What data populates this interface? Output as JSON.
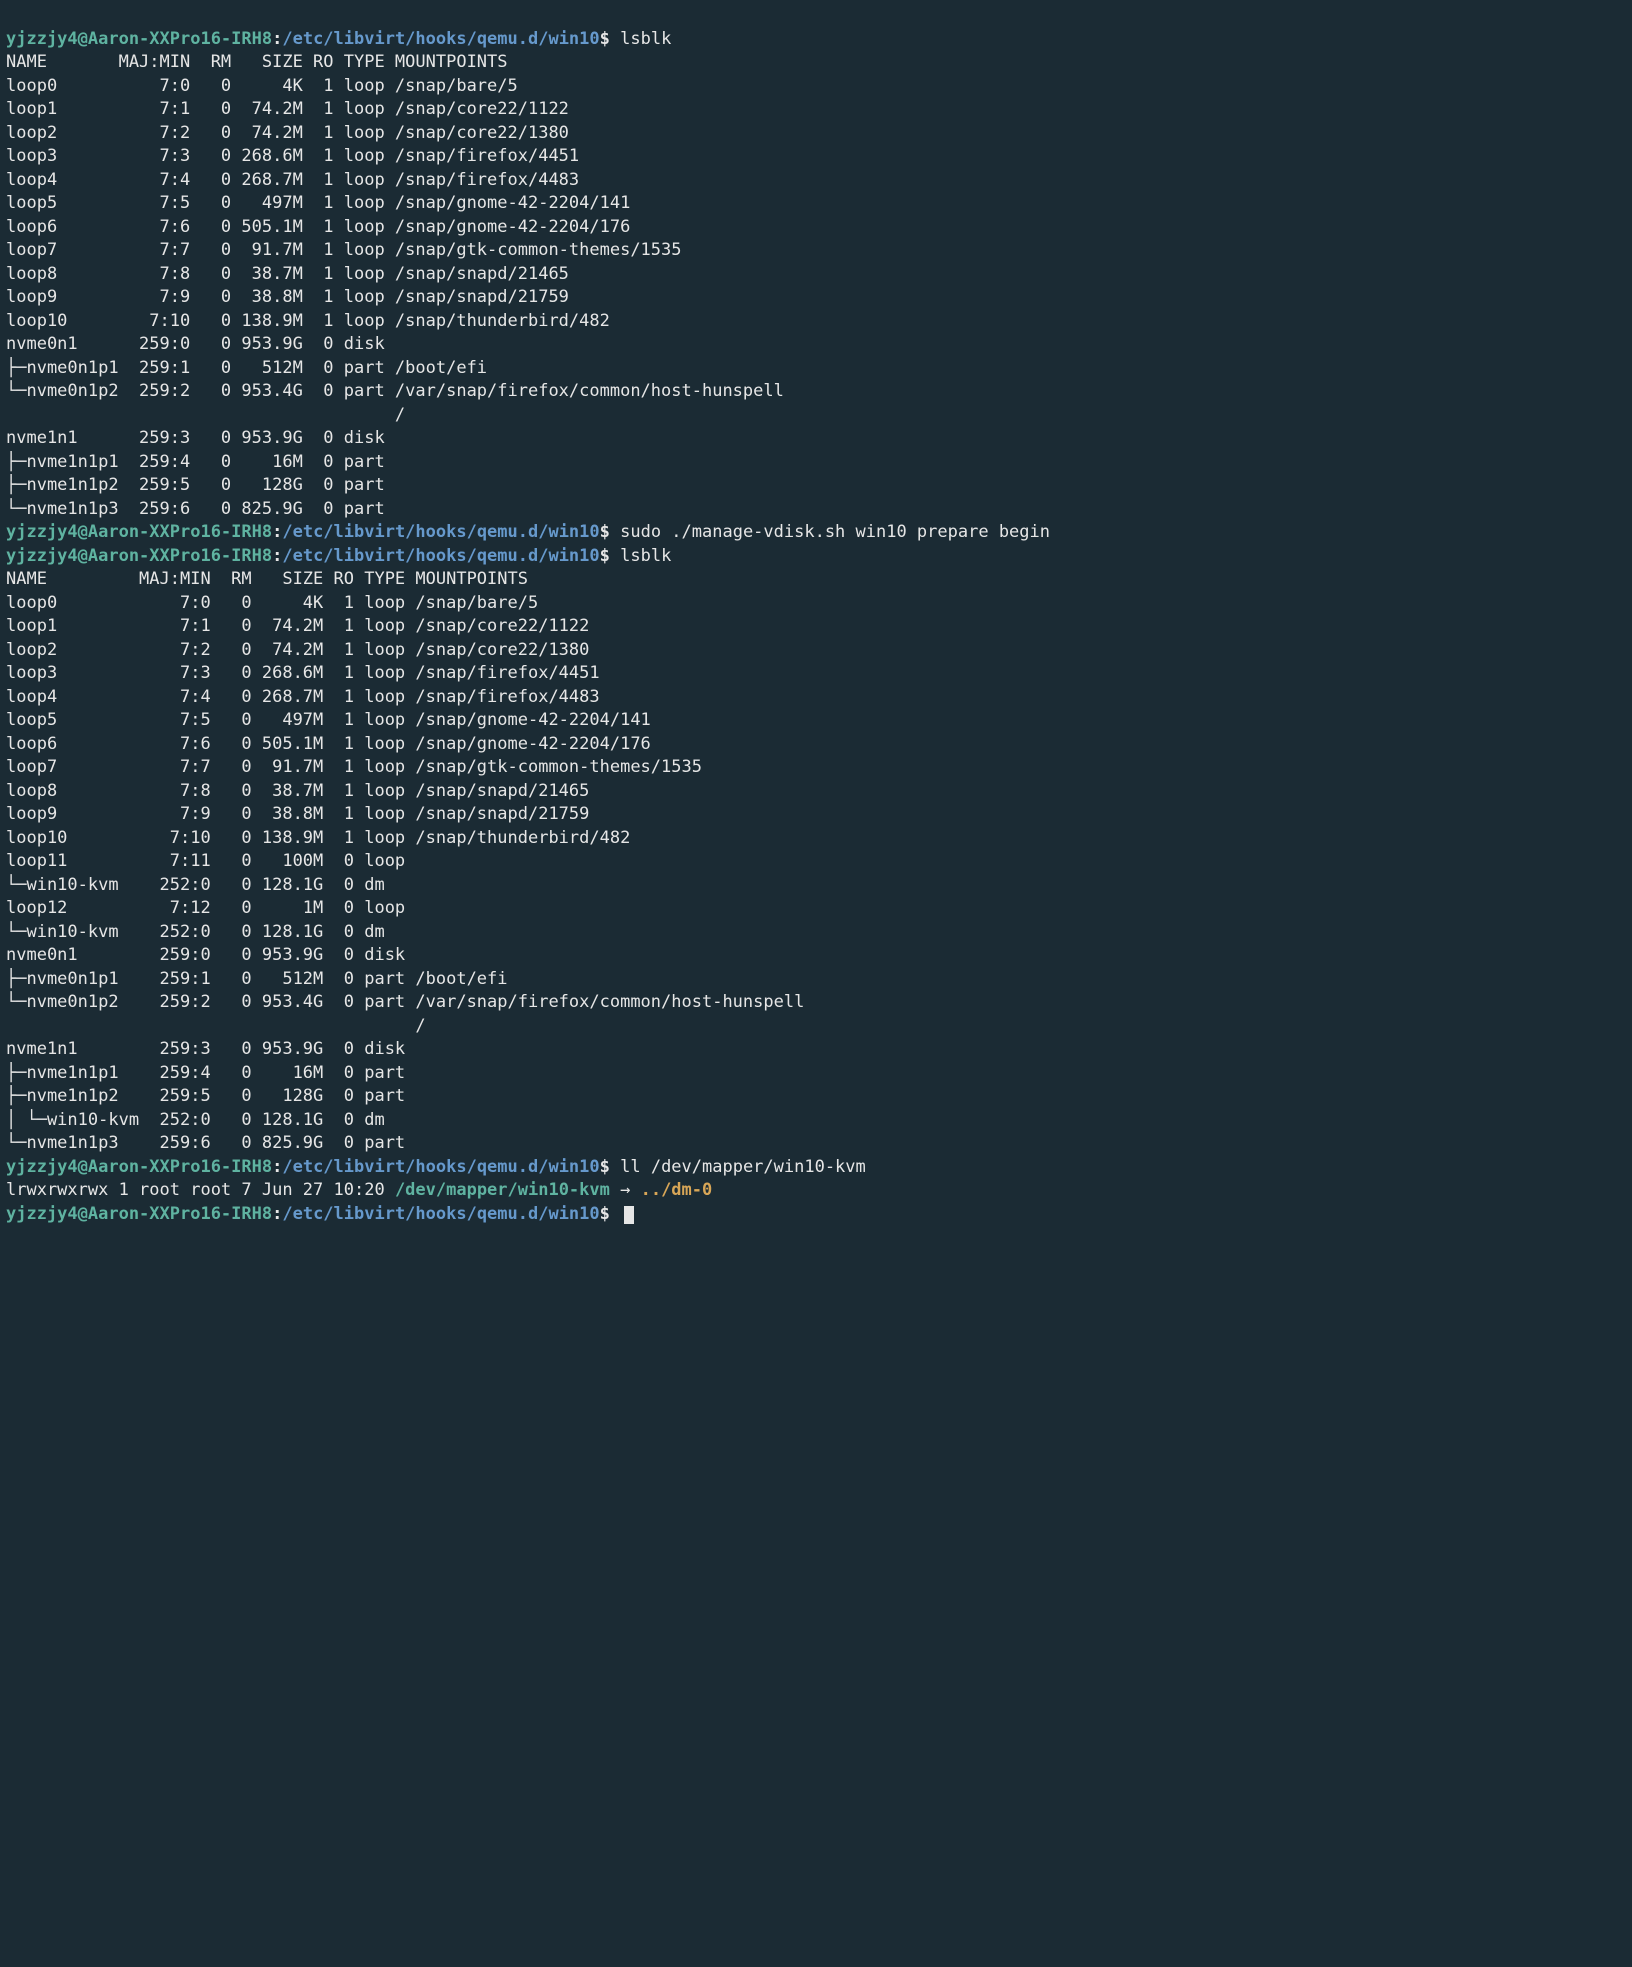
{
  "prompt": {
    "user": "yjzzjy4@Aaron-XXPro16-IRH8",
    "sep": ":",
    "path": "/etc/libvirt/hooks/qemu.d/win10",
    "dollar": "$"
  },
  "commands": {
    "lsblk": "lsblk",
    "sudo_manage": "sudo ./manage-vdisk.sh win10 prepare begin",
    "ll": "ll /dev/mapper/win10-kvm"
  },
  "lsblk1": {
    "header": [
      "NAME",
      "MAJ:MIN",
      "RM",
      "SIZE",
      "RO",
      "TYPE",
      "MOUNTPOINTS"
    ],
    "col_widths": {
      "name": 11,
      "majmin": 7,
      "rm": 4,
      "size": 7,
      "ro": 3,
      "type": 4
    },
    "rows": [
      {
        "t": "",
        "n": "loop0",
        "mm": "7:0",
        "rm": "0",
        "sz": "4K",
        "ro": "1",
        "ty": "loop",
        "mp": "/snap/bare/5"
      },
      {
        "t": "",
        "n": "loop1",
        "mm": "7:1",
        "rm": "0",
        "sz": "74.2M",
        "ro": "1",
        "ty": "loop",
        "mp": "/snap/core22/1122"
      },
      {
        "t": "",
        "n": "loop2",
        "mm": "7:2",
        "rm": "0",
        "sz": "74.2M",
        "ro": "1",
        "ty": "loop",
        "mp": "/snap/core22/1380"
      },
      {
        "t": "",
        "n": "loop3",
        "mm": "7:3",
        "rm": "0",
        "sz": "268.6M",
        "ro": "1",
        "ty": "loop",
        "mp": "/snap/firefox/4451"
      },
      {
        "t": "",
        "n": "loop4",
        "mm": "7:4",
        "rm": "0",
        "sz": "268.7M",
        "ro": "1",
        "ty": "loop",
        "mp": "/snap/firefox/4483"
      },
      {
        "t": "",
        "n": "loop5",
        "mm": "7:5",
        "rm": "0",
        "sz": "497M",
        "ro": "1",
        "ty": "loop",
        "mp": "/snap/gnome-42-2204/141"
      },
      {
        "t": "",
        "n": "loop6",
        "mm": "7:6",
        "rm": "0",
        "sz": "505.1M",
        "ro": "1",
        "ty": "loop",
        "mp": "/snap/gnome-42-2204/176"
      },
      {
        "t": "",
        "n": "loop7",
        "mm": "7:7",
        "rm": "0",
        "sz": "91.7M",
        "ro": "1",
        "ty": "loop",
        "mp": "/snap/gtk-common-themes/1535"
      },
      {
        "t": "",
        "n": "loop8",
        "mm": "7:8",
        "rm": "0",
        "sz": "38.7M",
        "ro": "1",
        "ty": "loop",
        "mp": "/snap/snapd/21465"
      },
      {
        "t": "",
        "n": "loop9",
        "mm": "7:9",
        "rm": "0",
        "sz": "38.8M",
        "ro": "1",
        "ty": "loop",
        "mp": "/snap/snapd/21759"
      },
      {
        "t": "",
        "n": "loop10",
        "mm": "7:10",
        "rm": "0",
        "sz": "138.9M",
        "ro": "1",
        "ty": "loop",
        "mp": "/snap/thunderbird/482"
      },
      {
        "t": "",
        "n": "nvme0n1",
        "mm": "259:0",
        "rm": "0",
        "sz": "953.9G",
        "ro": "0",
        "ty": "disk",
        "mp": ""
      },
      {
        "t": "├─",
        "n": "nvme0n1p1",
        "mm": "259:1",
        "rm": "0",
        "sz": "512M",
        "ro": "0",
        "ty": "part",
        "mp": "/boot/efi"
      },
      {
        "t": "└─",
        "n": "nvme0n1p2",
        "mm": "259:2",
        "rm": "0",
        "sz": "953.4G",
        "ro": "0",
        "ty": "part",
        "mp": "/var/snap/firefox/common/host-hunspell"
      },
      {
        "t": "",
        "n": "",
        "mm": "",
        "rm": "",
        "sz": "",
        "ro": "",
        "ty": "",
        "mp": "/"
      },
      {
        "t": "",
        "n": "nvme1n1",
        "mm": "259:3",
        "rm": "0",
        "sz": "953.9G",
        "ro": "0",
        "ty": "disk",
        "mp": ""
      },
      {
        "t": "├─",
        "n": "nvme1n1p1",
        "mm": "259:4",
        "rm": "0",
        "sz": "16M",
        "ro": "0",
        "ty": "part",
        "mp": ""
      },
      {
        "t": "├─",
        "n": "nvme1n1p2",
        "mm": "259:5",
        "rm": "0",
        "sz": "128G",
        "ro": "0",
        "ty": "part",
        "mp": ""
      },
      {
        "t": "└─",
        "n": "nvme1n1p3",
        "mm": "259:6",
        "rm": "0",
        "sz": "825.9G",
        "ro": "0",
        "ty": "part",
        "mp": ""
      }
    ]
  },
  "lsblk2": {
    "header": [
      "NAME",
      "MAJ:MIN",
      "RM",
      "SIZE",
      "RO",
      "TYPE",
      "MOUNTPOINTS"
    ],
    "col_widths": {
      "name": 13,
      "majmin": 7,
      "rm": 4,
      "size": 7,
      "ro": 3,
      "type": 4
    },
    "rows": [
      {
        "t": "",
        "n": "loop0",
        "mm": "7:0",
        "rm": "0",
        "sz": "4K",
        "ro": "1",
        "ty": "loop",
        "mp": "/snap/bare/5"
      },
      {
        "t": "",
        "n": "loop1",
        "mm": "7:1",
        "rm": "0",
        "sz": "74.2M",
        "ro": "1",
        "ty": "loop",
        "mp": "/snap/core22/1122"
      },
      {
        "t": "",
        "n": "loop2",
        "mm": "7:2",
        "rm": "0",
        "sz": "74.2M",
        "ro": "1",
        "ty": "loop",
        "mp": "/snap/core22/1380"
      },
      {
        "t": "",
        "n": "loop3",
        "mm": "7:3",
        "rm": "0",
        "sz": "268.6M",
        "ro": "1",
        "ty": "loop",
        "mp": "/snap/firefox/4451"
      },
      {
        "t": "",
        "n": "loop4",
        "mm": "7:4",
        "rm": "0",
        "sz": "268.7M",
        "ro": "1",
        "ty": "loop",
        "mp": "/snap/firefox/4483"
      },
      {
        "t": "",
        "n": "loop5",
        "mm": "7:5",
        "rm": "0",
        "sz": "497M",
        "ro": "1",
        "ty": "loop",
        "mp": "/snap/gnome-42-2204/141"
      },
      {
        "t": "",
        "n": "loop6",
        "mm": "7:6",
        "rm": "0",
        "sz": "505.1M",
        "ro": "1",
        "ty": "loop",
        "mp": "/snap/gnome-42-2204/176"
      },
      {
        "t": "",
        "n": "loop7",
        "mm": "7:7",
        "rm": "0",
        "sz": "91.7M",
        "ro": "1",
        "ty": "loop",
        "mp": "/snap/gtk-common-themes/1535"
      },
      {
        "t": "",
        "n": "loop8",
        "mm": "7:8",
        "rm": "0",
        "sz": "38.7M",
        "ro": "1",
        "ty": "loop",
        "mp": "/snap/snapd/21465"
      },
      {
        "t": "",
        "n": "loop9",
        "mm": "7:9",
        "rm": "0",
        "sz": "38.8M",
        "ro": "1",
        "ty": "loop",
        "mp": "/snap/snapd/21759"
      },
      {
        "t": "",
        "n": "loop10",
        "mm": "7:10",
        "rm": "0",
        "sz": "138.9M",
        "ro": "1",
        "ty": "loop",
        "mp": "/snap/thunderbird/482"
      },
      {
        "t": "",
        "n": "loop11",
        "mm": "7:11",
        "rm": "0",
        "sz": "100M",
        "ro": "0",
        "ty": "loop",
        "mp": ""
      },
      {
        "t": "└─",
        "n": "win10-kvm",
        "mm": "252:0",
        "rm": "0",
        "sz": "128.1G",
        "ro": "0",
        "ty": "dm",
        "mp": ""
      },
      {
        "t": "",
        "n": "loop12",
        "mm": "7:12",
        "rm": "0",
        "sz": "1M",
        "ro": "0",
        "ty": "loop",
        "mp": ""
      },
      {
        "t": "└─",
        "n": "win10-kvm",
        "mm": "252:0",
        "rm": "0",
        "sz": "128.1G",
        "ro": "0",
        "ty": "dm",
        "mp": ""
      },
      {
        "t": "",
        "n": "nvme0n1",
        "mm": "259:0",
        "rm": "0",
        "sz": "953.9G",
        "ro": "0",
        "ty": "disk",
        "mp": ""
      },
      {
        "t": "├─",
        "n": "nvme0n1p1",
        "mm": "259:1",
        "rm": "0",
        "sz": "512M",
        "ro": "0",
        "ty": "part",
        "mp": "/boot/efi"
      },
      {
        "t": "└─",
        "n": "nvme0n1p2",
        "mm": "259:2",
        "rm": "0",
        "sz": "953.4G",
        "ro": "0",
        "ty": "part",
        "mp": "/var/snap/firefox/common/host-hunspell"
      },
      {
        "t": "",
        "n": "",
        "mm": "",
        "rm": "",
        "sz": "",
        "ro": "",
        "ty": "",
        "mp": "/"
      },
      {
        "t": "",
        "n": "nvme1n1",
        "mm": "259:3",
        "rm": "0",
        "sz": "953.9G",
        "ro": "0",
        "ty": "disk",
        "mp": ""
      },
      {
        "t": "├─",
        "n": "nvme1n1p1",
        "mm": "259:4",
        "rm": "0",
        "sz": "16M",
        "ro": "0",
        "ty": "part",
        "mp": ""
      },
      {
        "t": "├─",
        "n": "nvme1n1p2",
        "mm": "259:5",
        "rm": "0",
        "sz": "128G",
        "ro": "0",
        "ty": "part",
        "mp": ""
      },
      {
        "t": "│ └─",
        "n": "win10-kvm",
        "mm": "252:0",
        "rm": "0",
        "sz": "128.1G",
        "ro": "0",
        "ty": "dm",
        "mp": ""
      },
      {
        "t": "└─",
        "n": "nvme1n1p3",
        "mm": "259:6",
        "rm": "0",
        "sz": "825.9G",
        "ro": "0",
        "ty": "part",
        "mp": ""
      }
    ]
  },
  "ll_output": {
    "perm": "lrwxrwxrwx",
    "links": "1",
    "owner": "root",
    "group": "root",
    "size": "7",
    "date": "Jun 27 10:20",
    "link_name": "/dev/mapper/win10-kvm",
    "arrow": "→",
    "target": "../dm-0"
  }
}
